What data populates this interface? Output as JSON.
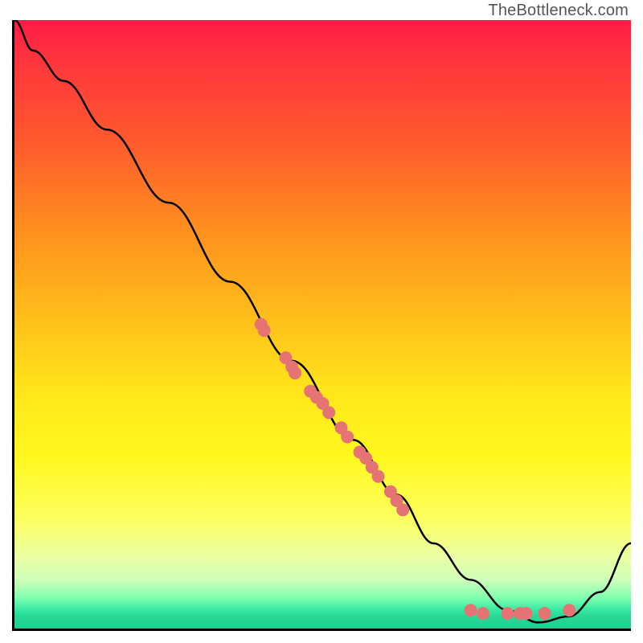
{
  "watermark": "TheBottleneck.com",
  "chart_data": {
    "type": "line",
    "title": "",
    "xlabel": "",
    "ylabel": "",
    "xlim": [
      0,
      100
    ],
    "ylim": [
      0,
      100
    ],
    "grid": false,
    "series": [
      {
        "name": "curve",
        "x": [
          0,
          3,
          8,
          15,
          25,
          35,
          45,
          55,
          62,
          68,
          74,
          80,
          85,
          90,
          95,
          100
        ],
        "values": [
          100,
          95,
          90,
          82,
          70,
          57,
          44,
          31,
          22,
          14,
          8,
          3,
          1,
          2,
          6,
          14
        ]
      }
    ],
    "scatter_points": [
      {
        "x": 40,
        "y": 50
      },
      {
        "x": 40.5,
        "y": 49
      },
      {
        "x": 44,
        "y": 44.5
      },
      {
        "x": 45,
        "y": 43
      },
      {
        "x": 45.5,
        "y": 42
      },
      {
        "x": 48,
        "y": 39
      },
      {
        "x": 49,
        "y": 38
      },
      {
        "x": 50,
        "y": 37
      },
      {
        "x": 51,
        "y": 35.5
      },
      {
        "x": 53,
        "y": 33
      },
      {
        "x": 54,
        "y": 31.5
      },
      {
        "x": 56,
        "y": 29
      },
      {
        "x": 57,
        "y": 28
      },
      {
        "x": 58,
        "y": 26.5
      },
      {
        "x": 59,
        "y": 25
      },
      {
        "x": 61,
        "y": 22.5
      },
      {
        "x": 62,
        "y": 21
      },
      {
        "x": 63,
        "y": 19.5
      },
      {
        "x": 74,
        "y": 3
      },
      {
        "x": 76,
        "y": 2.5
      },
      {
        "x": 80,
        "y": 2.5
      },
      {
        "x": 82,
        "y": 2.5
      },
      {
        "x": 83,
        "y": 2.5
      },
      {
        "x": 86,
        "y": 2.5
      },
      {
        "x": 90,
        "y": 3
      }
    ]
  }
}
